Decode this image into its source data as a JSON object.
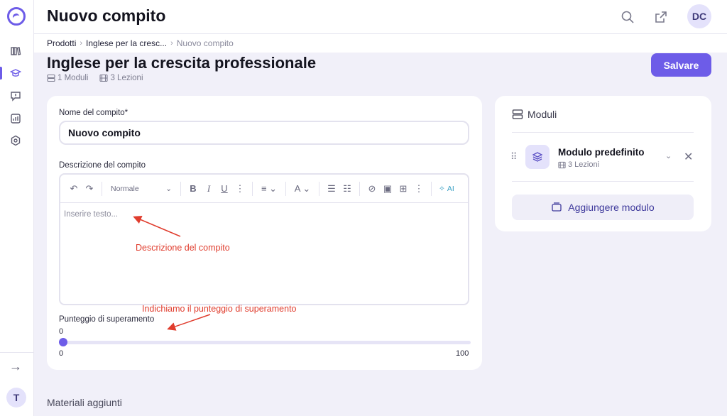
{
  "header": {
    "title": "Nuovo compito",
    "avatar": "DC"
  },
  "breadcrumb": {
    "items": [
      "Prodotti",
      "Inglese per la cresc...",
      "Nuovo compito"
    ]
  },
  "course": {
    "title": "Inglese per la crescita professionale",
    "modules": "1 Moduli",
    "lessons": "3 Lezioni"
  },
  "actions": {
    "save": "Salvare"
  },
  "form": {
    "name_label": "Nome del compito*",
    "name_value": "Nuovo compito",
    "desc_label": "Descrizione del compito",
    "editor": {
      "style": "Normale",
      "placeholder": "Inserire testo...",
      "ai": "AI"
    },
    "score_label": "Punteggio di superamento",
    "score_value": "0",
    "score_min": "0",
    "score_max": "100",
    "score_fraction": 0
  },
  "annotations": {
    "desc": "Descrizione del compito",
    "score": "Indichiamo il punteggio di superamento"
  },
  "modules_panel": {
    "title": "Moduli",
    "module": {
      "name": "Modulo predefinito",
      "lessons": "3 Lezioni"
    },
    "add": "Aggiungere modulo"
  },
  "materials": {
    "title": "Materiali aggiunti"
  },
  "sidebar": {
    "user_initial": "T"
  },
  "colors": {
    "accent": "#6d5ce8",
    "annotation": "#e03d2e"
  }
}
